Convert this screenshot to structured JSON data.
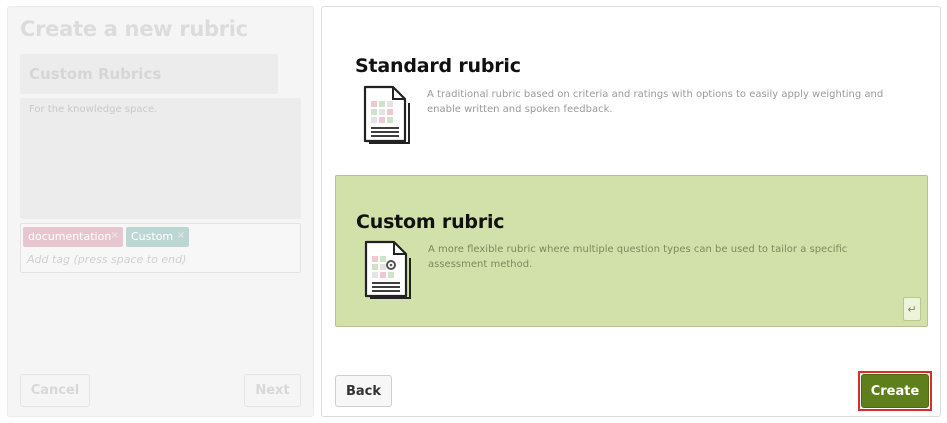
{
  "left": {
    "title": "Create a new rubric",
    "name_value": "Custom Rubrics",
    "description_value": "For the knowledge space.",
    "tags": [
      {
        "label": "documentation",
        "remove": "×"
      },
      {
        "label": "Custom",
        "remove": "×"
      }
    ],
    "tag_placeholder": "Add tag (press space to end)",
    "cancel_label": "Cancel",
    "next_label": "Next"
  },
  "options": [
    {
      "title": "Standard rubric",
      "description": "A traditional rubric based on criteria and ratings with options to easily apply weighting and enable written and spoken feedback.",
      "icon": "document-grid-icon"
    },
    {
      "title": "Custom rubric",
      "description": "A more flexible rubric where multiple question types can be used to tailor a specific assessment method.",
      "icon": "document-gear-icon",
      "selected": true,
      "enter_glyph": "↵"
    }
  ],
  "footer": {
    "back_label": "Back",
    "create_label": "Create"
  },
  "colors": {
    "selected_bg": "#d2e0aa",
    "create_bg": "#5f7f1c",
    "focus_outline": "#e02a2a"
  }
}
